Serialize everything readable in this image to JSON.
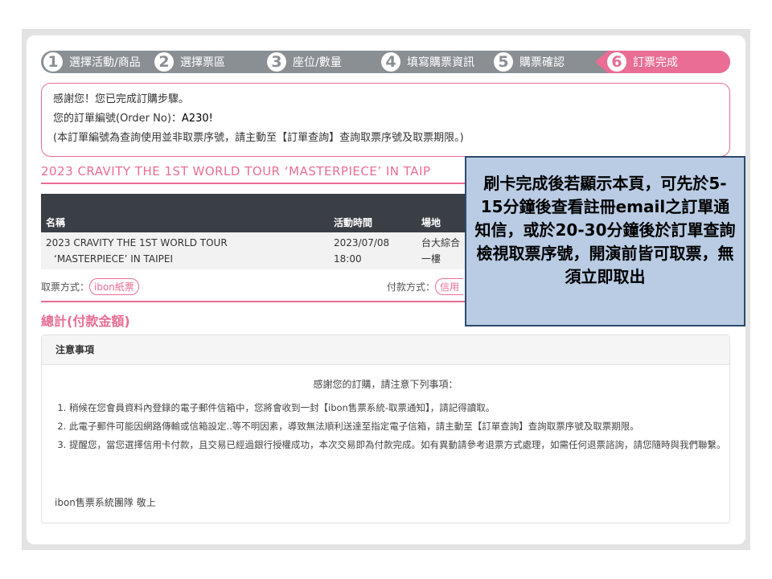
{
  "steps": [
    {
      "num": "1",
      "label": "選擇活動/商品"
    },
    {
      "num": "2",
      "label": "選擇票區"
    },
    {
      "num": "3",
      "label": "座位/數量"
    },
    {
      "num": "4",
      "label": "填寫購票資訊"
    },
    {
      "num": "5",
      "label": "購票確認"
    },
    {
      "num": "6",
      "label": "訂票完成"
    }
  ],
  "notice": {
    "thanks": "感謝您！您已完成訂購步驟。",
    "order_label": "您的訂單編號(Order No)：",
    "order_number": "A230!",
    "hint": "(本訂單編號為查詢使用並非取票序號，請主動至【訂單查詢】查詢取票序號及取票期限。)"
  },
  "event_title": "2023 CRAVITY THE 1ST WORLD TOUR ‘MASTERPIECE’ IN TAIP",
  "table": {
    "headers": [
      "名稱",
      "活動時間",
      "場地"
    ],
    "row": {
      "name_line1": "2023 CRAVITY THE 1ST WORLD TOUR",
      "name_line2": "‘MASTERPIECE’ IN TAIPEI",
      "date": "2023/07/08",
      "time": "18:00",
      "venue_line1": "台大綜合",
      "venue_line2": "一樓"
    }
  },
  "pickup": {
    "label": "取票方式：",
    "value": "ibon紙票"
  },
  "payment": {
    "label": "付款方式：",
    "value": "信用"
  },
  "total_label": "總計(付款金額)",
  "notes": {
    "title": "注意事項",
    "intro": "感謝您的訂購，請注意下列事項：",
    "items": [
      "稍候在您會員資料內登錄的電子郵件信箱中，您將會收到一封【ibon售票系統-取票通知】，請記得讀取。",
      "此電子郵件可能因網路傳輸或信箱設定..等不明因素，導致無法順利送達至指定電子信箱，請主動至【訂單查詢】查詢取票序號及取票期限。",
      "提醒您，當您選擇信用卡付款，且交易已經過銀行授權成功，本次交易即為付款完成。如有異動請參考退票方式處理，如需任何退票諮詢，請您隨時與我們聯繫。"
    ],
    "signoff": "ibon售票系統團隊 敬上"
  },
  "callout": "刷卡完成後若顯示本頁，可先於5-15分鐘後查看註冊email之訂單通知信，或於20-30分鐘後於訂單查詢檢視取票序號，開演前皆可取票，無須立即取出",
  "colors": {
    "accent": "#e96d94",
    "step_gray": "#8a8f94",
    "table_head": "#3a3f46",
    "callout_bg": "#b9cce4"
  }
}
